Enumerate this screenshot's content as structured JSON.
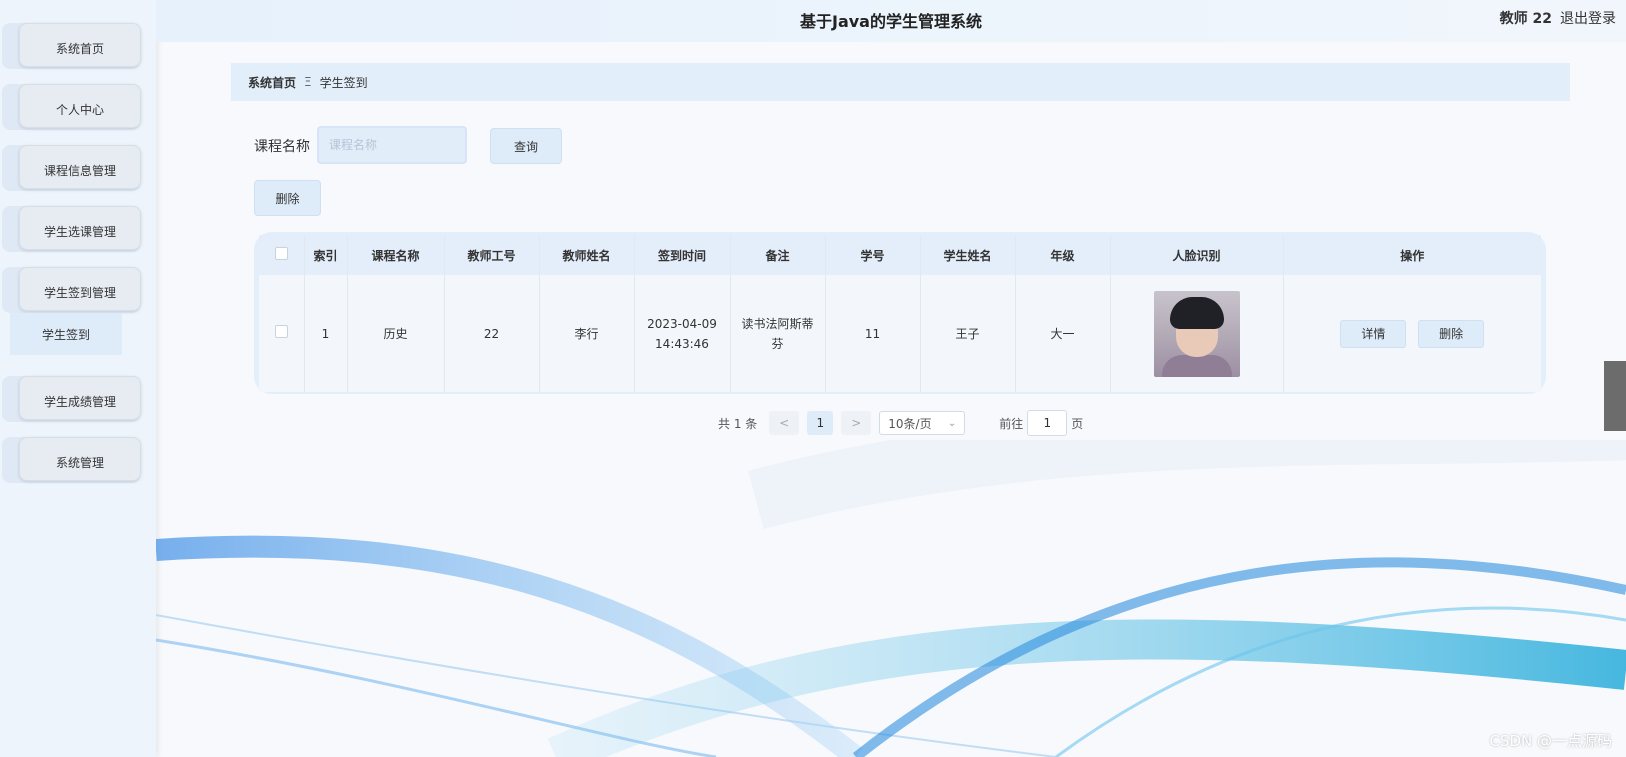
{
  "header": {
    "title": "基于Java的学生管理系统",
    "user": "教师 22",
    "logout": "退出登录"
  },
  "sidebar": {
    "items": [
      {
        "label": "系统首页"
      },
      {
        "label": "个人中心"
      },
      {
        "label": "课程信息管理"
      },
      {
        "label": "学生选课管理"
      },
      {
        "label": "学生签到管理"
      },
      {
        "label": "学生成绩管理"
      },
      {
        "label": "系统管理"
      }
    ],
    "submenu_active": "学生签到"
  },
  "breadcrumb": {
    "home": "系统首页",
    "separator": "Ξ",
    "current": "学生签到"
  },
  "search": {
    "label": "课程名称",
    "placeholder": "课程名称",
    "value": "",
    "query_button": "查询"
  },
  "toolbar": {
    "delete_button": "删除"
  },
  "table": {
    "columns": [
      "索引",
      "课程名称",
      "教师工号",
      "教师姓名",
      "签到时间",
      "备注",
      "学号",
      "学生姓名",
      "年级",
      "人脸识别",
      "操作"
    ],
    "rows": [
      {
        "index": "1",
        "course": "历史",
        "teacher_id": "22",
        "teacher_name": "李行",
        "signin_date": "2023-04-09",
        "signin_time": "14:43:46",
        "remark": "读书法阿斯蒂芬",
        "student_id": "11",
        "student_name": "王子",
        "grade": "大一",
        "face_icon": "face-photo",
        "actions": {
          "detail": "详情",
          "delete": "删除"
        }
      }
    ]
  },
  "pagination": {
    "total": "共 1 条",
    "prev": "<",
    "current_page": "1",
    "next": ">",
    "page_size": "10条/页",
    "goto_label": "前往",
    "goto_value": "1",
    "page_suffix": "页"
  },
  "watermark": "CSDN @一点源码",
  "colors": {
    "accent": "#deebf8",
    "header_bg": "#e6f1fc",
    "sidebar_bg": "#eef4fb"
  }
}
